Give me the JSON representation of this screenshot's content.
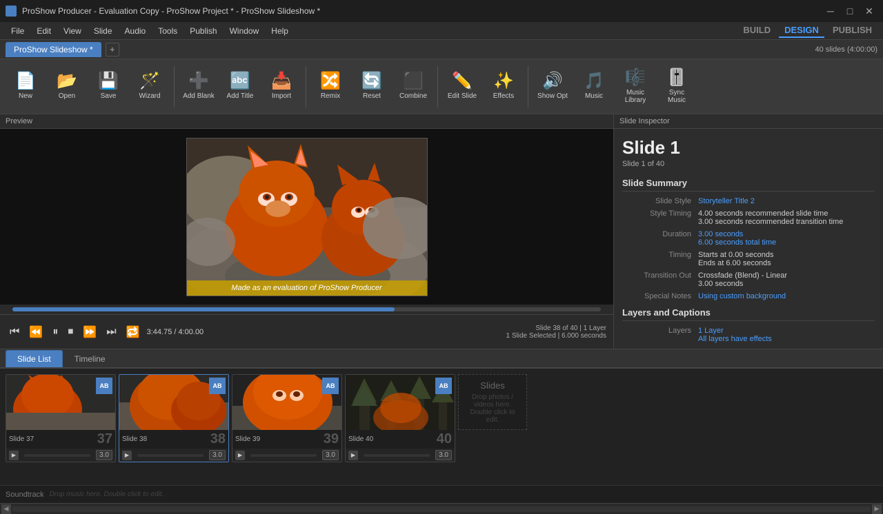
{
  "titlebar": {
    "title": "ProShow Producer - Evaluation Copy - ProShow Project * - ProShow Slideshow *",
    "min_btn": "─",
    "max_btn": "□",
    "close_btn": "✕"
  },
  "menu": {
    "items": [
      "File",
      "Edit",
      "View",
      "Slide",
      "Audio",
      "Tools",
      "Publish",
      "Window",
      "Help"
    ],
    "right_items": {
      "build": "BUILD",
      "design": "DESIGN",
      "publish": "PUBLISH"
    }
  },
  "tab": {
    "label": "ProShow Slideshow *",
    "add_label": "+",
    "slides_count": "40 slides (4:00:00)"
  },
  "toolbar": {
    "new_label": "New",
    "open_label": "Open",
    "save_label": "Save",
    "wizard_label": "Wizard",
    "add_blank_label": "Add Blank",
    "add_title_label": "Add Title",
    "import_label": "Import",
    "remix_label": "Remix",
    "reset_label": "Reset",
    "combine_label": "Combine",
    "edit_slide_label": "Edit Slide",
    "effects_label": "Effects",
    "show_opt_label": "Show Opt",
    "music_label": "Music",
    "music_library_label": "Music Library",
    "sync_music_label": "Sync Music"
  },
  "preview": {
    "header": "Preview",
    "watermark": "Made as an evaluation of  ProShow Producer",
    "time": "3:44.75 / 4:00.00",
    "slide_info_line1": "Slide 38 of 40  |  1 Layer",
    "slide_info_line2": "1 Slide Selected  |  6.000 seconds"
  },
  "inspector": {
    "header": "Slide Inspector",
    "slide_title": "Slide 1",
    "slide_subtitle": "Slide 1 of 40",
    "summary_title": "Slide Summary",
    "rows": [
      {
        "label": "Slide Style",
        "value": "Storyteller Title 2",
        "link": true
      },
      {
        "label": "Style Timing",
        "value": "4.00 seconds recommended slide time\n3.00 seconds recommended transition time",
        "link": false
      },
      {
        "label": "Duration",
        "value": "3.00 seconds",
        "link": true,
        "value2": "6.00 seconds total time",
        "link2": true
      },
      {
        "label": "Timing",
        "value": "Starts at 0.00 seconds\nEnds at 6.00 seconds",
        "link": false
      },
      {
        "label": "Transition Out",
        "value": "Crossfade (Blend) - Linear\n3.00 seconds",
        "link": false
      },
      {
        "label": "Special Notes",
        "value": "Using custom background",
        "link": true
      }
    ],
    "layers_title": "Layers and Captions",
    "layers_label": "Layers",
    "layers_value": "1 Layer",
    "layers_link": true,
    "layers_effects": "All layers have effects",
    "layers_effects_link": true
  },
  "bottom_tabs": [
    {
      "label": "Slide List",
      "active": true
    },
    {
      "label": "Timeline",
      "active": false
    }
  ],
  "slides": [
    {
      "id": "slide-37",
      "label": "Slide 37",
      "num": "37",
      "duration": "3.0",
      "active": false
    },
    {
      "id": "slide-38",
      "label": "Slide 38",
      "num": "38",
      "duration": "3.0",
      "active": true
    },
    {
      "id": "slide-39",
      "label": "Slide 39",
      "num": "39",
      "duration": "3.0",
      "active": false
    },
    {
      "id": "slide-40",
      "label": "Slide 40",
      "num": "40",
      "duration": "3.0",
      "active": false
    }
  ],
  "slides_placeholder": {
    "title": "Slides",
    "text": "Drop photos / videos here. Double click to edit."
  },
  "soundtrack": {
    "label": "Soundtrack",
    "hint": "Drop music here. Double click to edit."
  }
}
